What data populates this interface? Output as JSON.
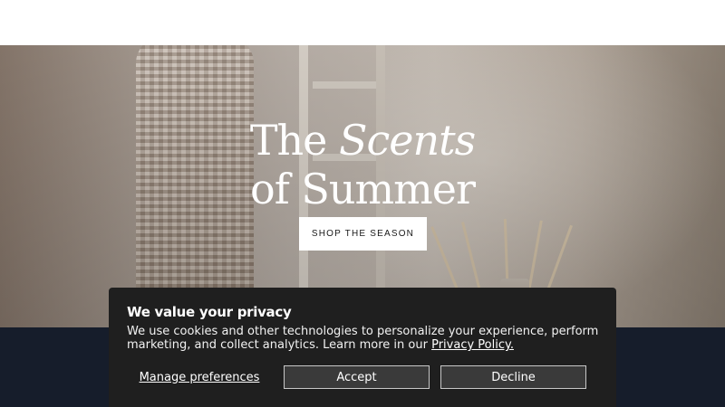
{
  "hero": {
    "title_line1_part1": "The",
    "title_line1_part2": "Scents",
    "title_line2": "of Summer",
    "shop_button_label": "SHOP THE SEASON"
  },
  "cookie_banner": {
    "title": "We value your privacy",
    "text": "We use cookies and other technologies to personalize your experience, perform marketing, and collect analytics. Learn more in our ",
    "privacy_link": "Privacy Policy.",
    "manage_label": "Manage preferences",
    "accept_label": "Accept",
    "decline_label": "Decline"
  },
  "colors": {
    "footer_navy": "#161d2b",
    "banner_bg": "#1f1f1f",
    "button_bg": "#3a3a3a"
  }
}
